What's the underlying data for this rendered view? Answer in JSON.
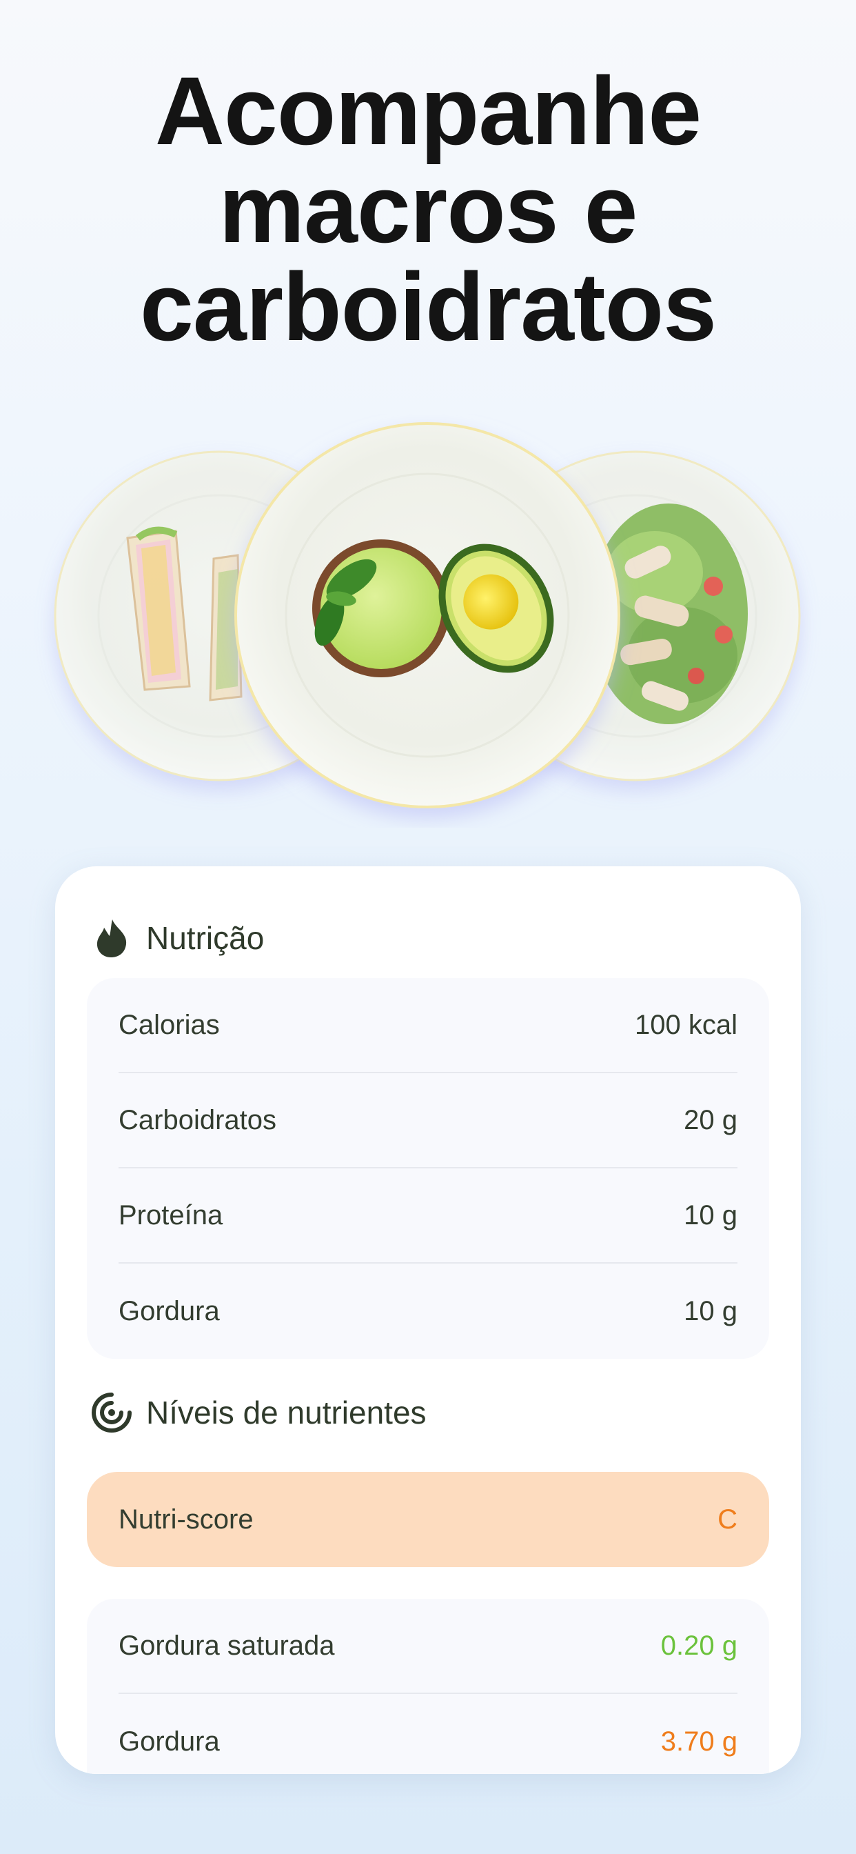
{
  "headline": {
    "line1": "Acompanhe",
    "line2": "macros e",
    "line3": "carboidratos"
  },
  "plates": {
    "left": "sandwich-plate",
    "center": "avocado-guacamole-plate",
    "right": "chicken-salad-plate"
  },
  "nutrition": {
    "title": "Nutrição",
    "icon": "flame-icon",
    "rows": [
      {
        "label": "Calorias",
        "value": "100 kcal"
      },
      {
        "label": "Carboidratos",
        "value": "20 g"
      },
      {
        "label": "Proteína",
        "value": "10 g"
      },
      {
        "label": "Gordura",
        "value": "10 g"
      }
    ]
  },
  "nutrient_levels": {
    "title": "Níveis de nutrientes",
    "icon": "target-icon",
    "nutri_score": {
      "label": "Nutri-score",
      "value": "C",
      "color": "#ef7d1c"
    },
    "rows": [
      {
        "label": "Gordura saturada",
        "value": "0.20 g",
        "color": "#6bc23c"
      },
      {
        "label": "Gordura",
        "value": "3.70 g",
        "color": "#ef7d1c"
      }
    ]
  },
  "colors": {
    "text_dark": "#333d30",
    "green": "#6bc23c",
    "orange": "#ef7d1c",
    "nutri_bg": "#fddcbf"
  }
}
